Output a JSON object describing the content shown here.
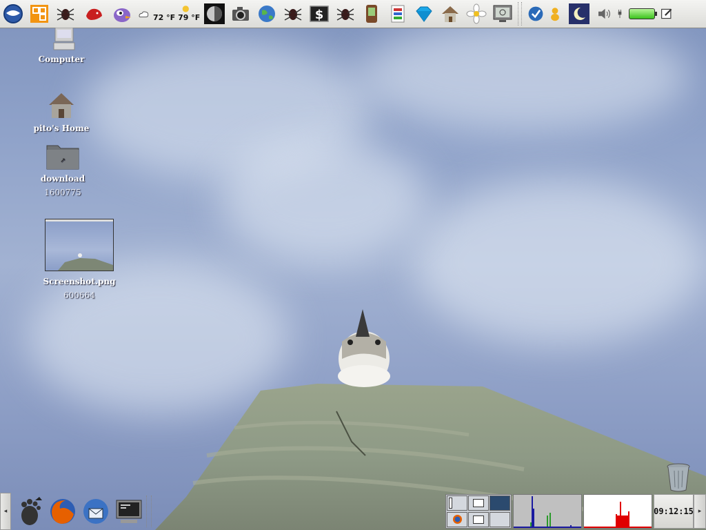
{
  "top_panel": {
    "icons": [
      "google-earth-icon",
      "vmware-icon",
      "spider-icon",
      "red-dragon-icon",
      "pidgin-icon",
      "cloudy-weather-icon"
    ],
    "weather_current": "72 °F",
    "weather_high": "79 °F",
    "icons_right": [
      "moon-phase-icon",
      "camera-icon",
      "globe-icon",
      "spider-icon",
      "dollar-terminal-icon",
      "spider-icon",
      "pda-icon",
      "card-game-icon",
      "diamond-icon",
      "home-icon",
      "flower-icon",
      "monitor-icon"
    ],
    "tray": [
      "checkmark-icon",
      "chat-user-icon",
      "night-moon-icon",
      "speaker-icon",
      "power-plug-icon",
      "battery-icon",
      "edit-note-icon"
    ]
  },
  "desktop": {
    "computer_label": "Computer",
    "home_label": "pito's Home",
    "download_label": "download",
    "download_size": "1600775",
    "screenshot_label": "Screenshot.png",
    "screenshot_size": "600664"
  },
  "bottom_panel": {
    "launchers": [
      "gnome-foot-icon",
      "firefox-icon",
      "thunderbird-icon",
      "terminal-icon"
    ],
    "clock": "09:12:15"
  },
  "colors": {
    "sky": "#8fa2c9",
    "panel": "#e6e6e3",
    "cpu_graph_bg": "#c0c0c0",
    "net_graph_bg": "#ffffff",
    "net_graph_bar": "#e00000"
  }
}
